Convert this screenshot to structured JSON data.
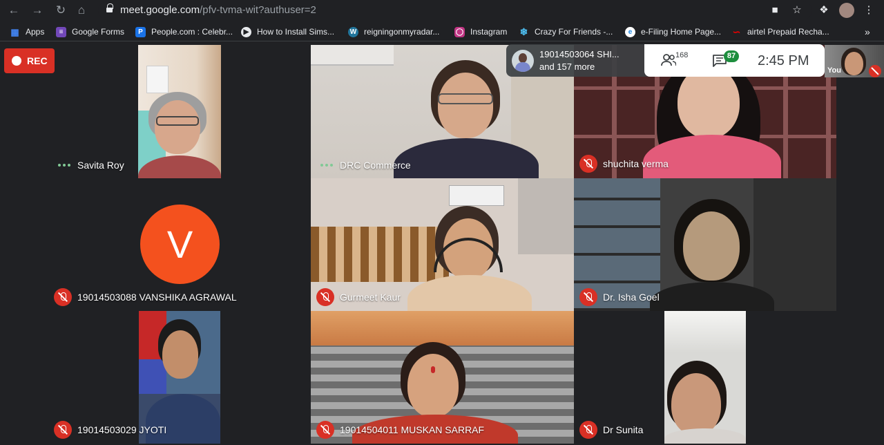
{
  "browser": {
    "url_host": "meet.google.com",
    "url_path": "/pfv-tvma-wit?authuser=2",
    "bookmarks": [
      {
        "label": "Apps",
        "icon": "apps-grid-icon",
        "color": "#4285f4"
      },
      {
        "label": "Google Forms",
        "icon": "google-forms-icon",
        "color": "#7248b9"
      },
      {
        "label": "People.com : Celebr...",
        "icon": "people-com-icon",
        "color": "#1a73e8"
      },
      {
        "label": "How to Install Sims...",
        "icon": "video-icon",
        "color": "#9aa0a6"
      },
      {
        "label": "reigningonmyradar...",
        "icon": "wordpress-icon",
        "color": "#21759b"
      },
      {
        "label": "Instagram",
        "icon": "instagram-icon",
        "color": "#c13584"
      },
      {
        "label": "Crazy For Friends -...",
        "icon": "snowflake-icon",
        "color": "#4fc3f7"
      },
      {
        "label": "e-Filing Home Page...",
        "icon": "efiling-icon",
        "color": "#1e88e5"
      },
      {
        "label": "airtel Prepaid Recha...",
        "icon": "airtel-icon",
        "color": "#e40000"
      }
    ],
    "overflow": "»"
  },
  "meet": {
    "rec_label": "REC",
    "presenter": {
      "line1": "19014503064 SHI...",
      "line2": "and 157 more"
    },
    "participants_count": "168",
    "chat_count": "87",
    "time": "2:45 PM",
    "self_label": "You",
    "avatar_letter": "V",
    "tiles": [
      {
        "name": "Savita Roy",
        "status": "speaking"
      },
      {
        "name": "DRC Commerce",
        "status": "speaking"
      },
      {
        "name": "shuchita verma",
        "status": "muted"
      },
      {
        "name": "19014503088 VANSHIKA AGRAWAL",
        "status": "muted"
      },
      {
        "name": "Gurmeet Kaur",
        "status": "muted"
      },
      {
        "name": "Dr. Isha Goel",
        "status": "muted"
      },
      {
        "name": "19014503029 JYOTI",
        "status": "muted"
      },
      {
        "name": "19014504011 MUSKAN SARRAF",
        "status": "muted"
      },
      {
        "name": "Dr Sunita",
        "status": "muted"
      }
    ]
  }
}
